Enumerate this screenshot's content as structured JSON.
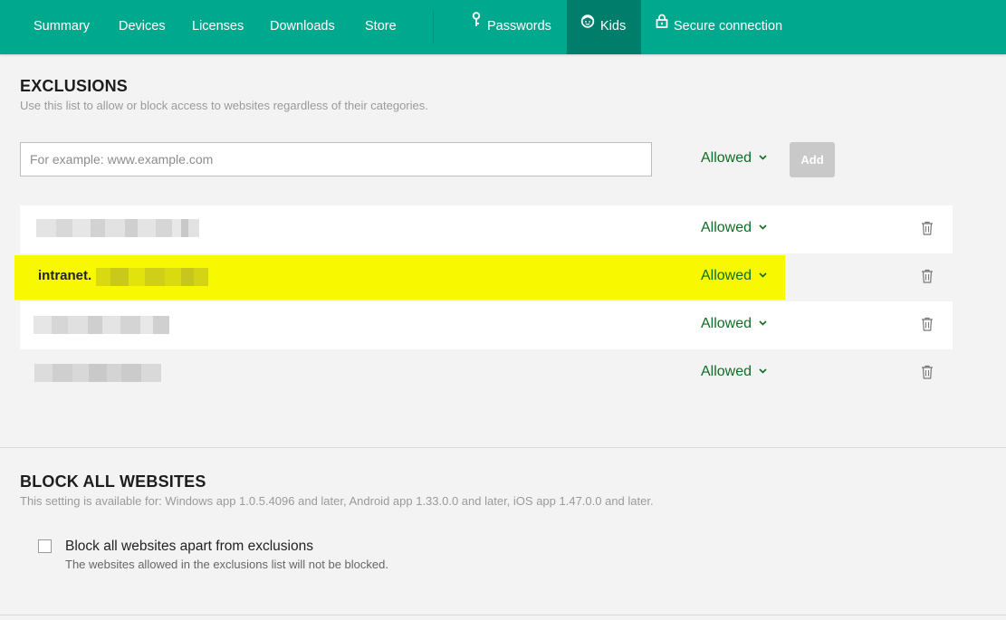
{
  "nav": {
    "items": [
      {
        "label": "Summary"
      },
      {
        "label": "Devices"
      },
      {
        "label": "Licenses"
      },
      {
        "label": "Downloads"
      },
      {
        "label": "Store"
      },
      {
        "label": "Passwords",
        "icon": "key-icon"
      },
      {
        "label": "Kids",
        "icon": "kids-icon",
        "active": true
      },
      {
        "label": "Secure connection",
        "icon": "lock-icon"
      }
    ],
    "bg_color": "#00a88e",
    "active_color": "#007e6c"
  },
  "exclusions": {
    "title": "EXCLUSIONS",
    "subtitle": "Use this list to allow or block access to websites regardless of their categories.",
    "input_placeholder": "For example: www.example.com",
    "input_value": "",
    "access_select": "Allowed",
    "add_label": "Add",
    "rows": [
      {
        "site": "",
        "access": "Allowed",
        "highlighted": false
      },
      {
        "site": "intranet.",
        "access": "Allowed",
        "highlighted": true
      },
      {
        "site": "",
        "access": "Allowed",
        "highlighted": false
      },
      {
        "site": "",
        "access": "Allowed",
        "highlighted": false
      }
    ],
    "highlight_color": "#f8f800",
    "allowed_color": "#0f6e24"
  },
  "block_all": {
    "title": "BLOCK ALL WEBSITES",
    "subtitle": "This setting is available for: Windows app 1.0.5.4096 and later, Android app 1.33.0.0 and later, iOS app 1.47.0.0 and later.",
    "checkbox_label": "Block all websites apart from exclusions",
    "checkbox_desc": "The websites allowed in the exclusions list will not be blocked.",
    "checked": false
  }
}
